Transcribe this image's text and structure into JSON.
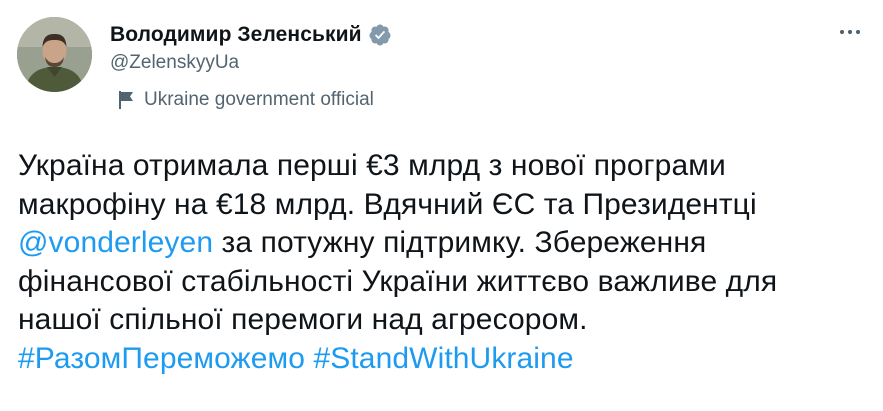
{
  "tweet": {
    "author": {
      "display_name": "Володимир Зеленський",
      "handle": "@ZelenskyyUa",
      "verified": true,
      "label": "Ukraine government official"
    },
    "text": {
      "line1": "Україна отримала перші €3 млрд з нової програми",
      "line2": "макрофіну на €18 млрд. Вдячний ЄС та Президентці",
      "mention": "@vonderleyen",
      "line3_rest": " за потужну підтримку. Збереження",
      "line4": "фінансової стабільності України життєво важливе для",
      "line5": "нашої спільної перемоги над агресором.",
      "hashtag1": "#РазомПереможемо",
      "hashtag2": "#StandWithUkraine"
    }
  },
  "icons": {
    "verified": "verified-badge-icon",
    "flag": "government-flag-icon",
    "more": "more-options-icon"
  },
  "colors": {
    "text": "#0f1419",
    "secondary": "#536471",
    "link": "#1d9bf0",
    "badge_gray": "#829aab"
  }
}
